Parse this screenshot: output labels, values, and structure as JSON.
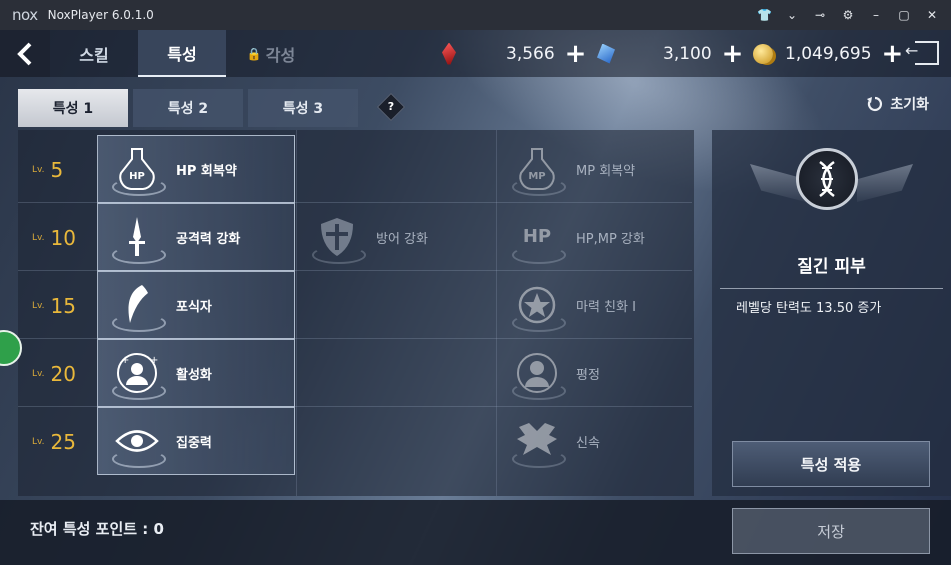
{
  "window": {
    "logo": "nox",
    "title": "NoxPlayer 6.0.1.0",
    "controls": [
      "shirt-icon",
      "chevron-down-icon",
      "pin-icon",
      "gear-icon",
      "minimize-icon",
      "maximize-icon",
      "close-icon"
    ]
  },
  "nav": {
    "tabs": [
      {
        "label": "스킬",
        "state": "normal"
      },
      {
        "label": "특성",
        "state": "active"
      },
      {
        "label": "각성",
        "state": "locked"
      }
    ],
    "currencies": [
      {
        "icon": "red-gem-icon",
        "value": "3,566"
      },
      {
        "icon": "blue-gem-icon",
        "value": "3,100"
      },
      {
        "icon": "gold-coins-icon",
        "value": "1,049,695"
      }
    ],
    "plus": "+"
  },
  "subtabs": [
    {
      "label": "특성 1",
      "active": true
    },
    {
      "label": "특성 2",
      "active": false
    },
    {
      "label": "특성 3",
      "active": false
    }
  ],
  "help": "?",
  "reset_label": "초기화",
  "levels": [
    {
      "prefix": "Lv.",
      "value": "5"
    },
    {
      "prefix": "Lv.",
      "value": "10"
    },
    {
      "prefix": "Lv.",
      "value": "15"
    },
    {
      "prefix": "Lv.",
      "value": "20"
    },
    {
      "prefix": "Lv.",
      "value": "25"
    }
  ],
  "traits": {
    "col1": [
      "HP 회복약",
      "공격력 강화",
      "포식자",
      "활성화",
      "집중력"
    ],
    "col2": [
      "방어 강화"
    ],
    "col3": [
      "MP 회복약",
      "HP,MP 강화",
      "마력 친화 I",
      "평정",
      "신속"
    ]
  },
  "detail": {
    "icon": "dna-icon",
    "title": "질긴 피부",
    "description": "레벨당 탄력도 13.50 증가",
    "apply_label": "특성 적용"
  },
  "footer": {
    "points_label": "잔여 특성 포인트 : 0",
    "save_label": "저장"
  },
  "colors": {
    "level": "#e9b83b",
    "accent": "#e8eef6"
  }
}
